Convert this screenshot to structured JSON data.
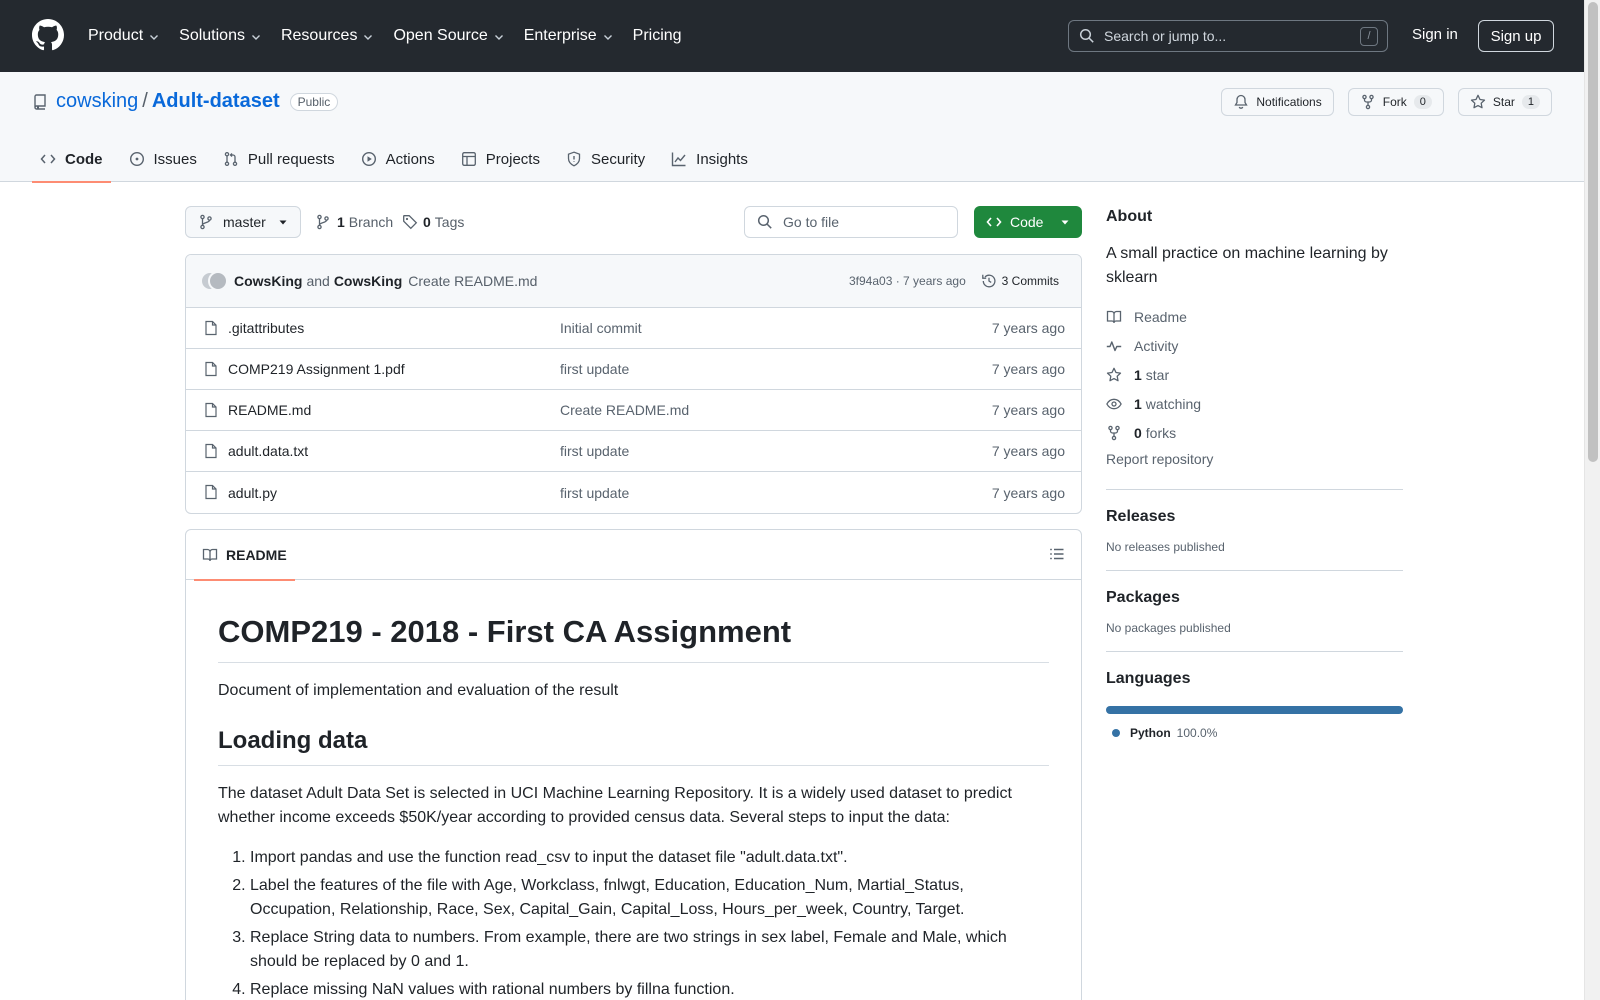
{
  "header": {
    "nav": [
      {
        "label": "Product",
        "has_caret": true
      },
      {
        "label": "Solutions",
        "has_caret": true
      },
      {
        "label": "Resources",
        "has_caret": true
      },
      {
        "label": "Open Source",
        "has_caret": true
      },
      {
        "label": "Enterprise",
        "has_caret": true
      },
      {
        "label": "Pricing",
        "has_caret": false
      }
    ],
    "search_placeholder": "Search or jump to...",
    "search_shortcut": "/",
    "sign_in": "Sign in",
    "sign_up": "Sign up"
  },
  "repo": {
    "owner": "cowsking",
    "separator": "/",
    "name": "Adult-dataset",
    "visibility": "Public",
    "notifications_label": "Notifications",
    "fork_label": "Fork",
    "fork_count": "0",
    "star_label": "Star",
    "star_count": "1",
    "tabs": [
      {
        "label": "Code",
        "icon": "code-icon",
        "active": true
      },
      {
        "label": "Issues",
        "icon": "issue-icon",
        "active": false
      },
      {
        "label": "Pull requests",
        "icon": "pull-request-icon",
        "active": false
      },
      {
        "label": "Actions",
        "icon": "play-icon",
        "active": false
      },
      {
        "label": "Projects",
        "icon": "table-icon",
        "active": false
      },
      {
        "label": "Security",
        "icon": "shield-icon",
        "active": false
      },
      {
        "label": "Insights",
        "icon": "graph-icon",
        "active": false
      }
    ]
  },
  "toolbar": {
    "branch": "master",
    "branch_count": "1",
    "branch_label": "Branch",
    "tag_count": "0",
    "tag_label": "Tags",
    "goto_placeholder": "Go to file",
    "code_label": "Code"
  },
  "latest_commit": {
    "author1": "CowsKing",
    "joiner": "and",
    "author2": "CowsKing",
    "message": "Create README.md",
    "meta": "3f94a03 · 7 years ago",
    "commits_label": "3 Commits"
  },
  "files": [
    {
      "name": ".gitattributes",
      "message": "Initial commit",
      "age": "7 years ago"
    },
    {
      "name": "COMP219 Assignment 1.pdf",
      "message": "first update",
      "age": "7 years ago"
    },
    {
      "name": "README.md",
      "message": "Create README.md",
      "age": "7 years ago"
    },
    {
      "name": "adult.data.txt",
      "message": "first update",
      "age": "7 years ago"
    },
    {
      "name": "adult.py",
      "message": "first update",
      "age": "7 years ago"
    }
  ],
  "readme": {
    "tab_label": "README",
    "h1": "COMP219 - 2018 - First CA Assignment",
    "intro": "Document of implementation and evaluation of the result",
    "h2": "Loading data",
    "para": "The dataset Adult Data Set is selected in UCI Machine Learning Repository. It is a widely used dataset to predict whether income exceeds $50K/year according to provided census data. Several steps to input the data:",
    "steps": [
      "Import pandas and use the function read_csv to input the dataset file \"adult.data.txt\".",
      "Label the features of the file with Age, Workclass, fnlwgt, Education, Education_Num, Martial_Status, Occupation, Relationship, Race, Sex, Capital_Gain, Capital_Loss, Hours_per_week, Country, Target.",
      "Replace String data to numbers. From example, there are two strings in sex label, Female and Male, which should be replaced by 0 and 1.",
      "Replace missing NaN values with rational numbers by fillna function."
    ]
  },
  "sidebar": {
    "about_title": "About",
    "description": "A small practice on machine learning by sklearn",
    "links": [
      {
        "icon": "book-icon",
        "count": "",
        "label": "Readme"
      },
      {
        "icon": "pulse-icon",
        "count": "",
        "label": "Activity"
      },
      {
        "icon": "star-icon",
        "count": "1",
        "label": "star"
      },
      {
        "icon": "eye-icon",
        "count": "1",
        "label": "watching"
      },
      {
        "icon": "fork-icon",
        "count": "0",
        "label": "forks"
      }
    ],
    "report": "Report repository",
    "releases_title": "Releases",
    "releases_note": "No releases published",
    "packages_title": "Packages",
    "packages_note": "No packages published",
    "languages_title": "Languages",
    "languages": [
      {
        "name": "Python",
        "percent": "100.0%",
        "fraction": 1.0,
        "color": "#3572a5"
      }
    ]
  },
  "colors": {
    "header_bg": "#24292f",
    "link": "#0969da",
    "primary_button": "#1f883d",
    "active_tab_underline": "#fd8c73"
  }
}
